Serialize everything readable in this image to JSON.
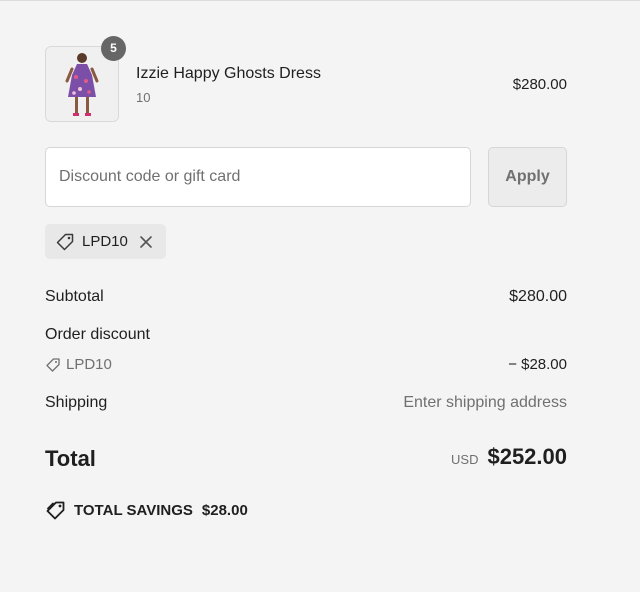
{
  "product": {
    "quantity_badge": "5",
    "name": "Izzie Happy Ghosts Dress",
    "variant": "10",
    "price": "$280.00"
  },
  "discount": {
    "placeholder": "Discount code or gift card",
    "value": "",
    "apply_label": "Apply",
    "applied_code": "LPD10"
  },
  "summary": {
    "subtotal_label": "Subtotal",
    "subtotal_value": "$280.00",
    "order_discount_label": "Order discount",
    "discount_code": "LPD10",
    "discount_value": "− $28.00",
    "shipping_label": "Shipping",
    "shipping_value": "Enter shipping address",
    "total_label": "Total",
    "total_currency": "USD",
    "total_value": "$252.00",
    "savings_label": "TOTAL SAVINGS",
    "savings_value": "$28.00"
  },
  "icons": {
    "tag": "tag-icon",
    "close": "close-icon",
    "savings": "savings-tag-icon"
  },
  "colors": {
    "background": "#f4f4f4",
    "badge": "#666666",
    "muted_text": "#707070",
    "chip": "#e8e8e8"
  }
}
